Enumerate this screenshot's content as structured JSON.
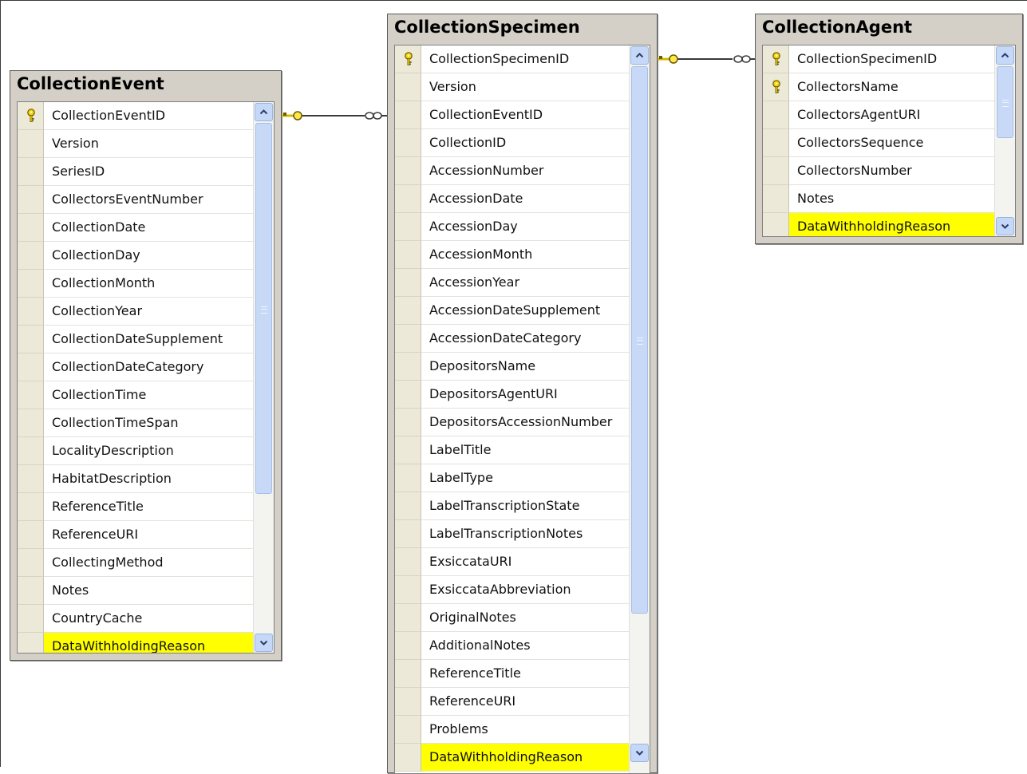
{
  "tables": {
    "collection_event": {
      "title": "CollectionEvent",
      "columns": [
        {
          "name": "CollectionEventID",
          "key": true
        },
        {
          "name": "Version"
        },
        {
          "name": "SeriesID"
        },
        {
          "name": "CollectorsEventNumber"
        },
        {
          "name": "CollectionDate"
        },
        {
          "name": "CollectionDay"
        },
        {
          "name": "CollectionMonth"
        },
        {
          "name": "CollectionYear"
        },
        {
          "name": "CollectionDateSupplement"
        },
        {
          "name": "CollectionDateCategory"
        },
        {
          "name": "CollectionTime"
        },
        {
          "name": "CollectionTimeSpan"
        },
        {
          "name": "LocalityDescription"
        },
        {
          "name": "HabitatDescription"
        },
        {
          "name": "ReferenceTitle"
        },
        {
          "name": "ReferenceURI"
        },
        {
          "name": "CollectingMethod"
        },
        {
          "name": "Notes"
        },
        {
          "name": "CountryCache"
        },
        {
          "name": "DataWithholdingReason",
          "highlight": true
        }
      ]
    },
    "collection_specimen": {
      "title": "CollectionSpecimen",
      "columns": [
        {
          "name": "CollectionSpecimenID",
          "key": true
        },
        {
          "name": "Version"
        },
        {
          "name": "CollectionEventID"
        },
        {
          "name": "CollectionID"
        },
        {
          "name": "AccessionNumber"
        },
        {
          "name": "AccessionDate"
        },
        {
          "name": "AccessionDay"
        },
        {
          "name": "AccessionMonth"
        },
        {
          "name": "AccessionYear"
        },
        {
          "name": "AccessionDateSupplement"
        },
        {
          "name": "AccessionDateCategory"
        },
        {
          "name": "DepositorsName"
        },
        {
          "name": "DepositorsAgentURI"
        },
        {
          "name": "DepositorsAccessionNumber"
        },
        {
          "name": "LabelTitle"
        },
        {
          "name": "LabelType"
        },
        {
          "name": "LabelTranscriptionState"
        },
        {
          "name": "LabelTranscriptionNotes"
        },
        {
          "name": "ExsiccataURI"
        },
        {
          "name": "ExsiccataAbbreviation"
        },
        {
          "name": "OriginalNotes"
        },
        {
          "name": "AdditionalNotes"
        },
        {
          "name": "ReferenceTitle"
        },
        {
          "name": "ReferenceURI"
        },
        {
          "name": "Problems"
        },
        {
          "name": "DataWithholdingReason",
          "highlight": true
        }
      ]
    },
    "collection_agent": {
      "title": "CollectionAgent",
      "columns": [
        {
          "name": "CollectionSpecimenID",
          "key": true
        },
        {
          "name": "CollectorsName",
          "key": true
        },
        {
          "name": "CollectorsAgentURI"
        },
        {
          "name": "CollectorsSequence"
        },
        {
          "name": "CollectorsNumber"
        },
        {
          "name": "Notes"
        },
        {
          "name": "DataWithholdingReason",
          "highlight": true
        }
      ]
    }
  },
  "relationships": [
    {
      "from": "collection_event",
      "to": "collection_specimen",
      "from_end": "one",
      "to_end": "many"
    },
    {
      "from": "collection_specimen",
      "to": "collection_agent",
      "from_end": "one",
      "to_end": "many"
    }
  ],
  "colors": {
    "highlight": "#ffff00",
    "key": "#d4b800",
    "connector": "#3a3a3a",
    "frame": "#d4d0c8"
  },
  "icons": [
    "primary-key-icon",
    "scroll-up-icon",
    "scroll-down-icon",
    "relationship-key-end-icon",
    "relationship-infinity-end-icon"
  ]
}
